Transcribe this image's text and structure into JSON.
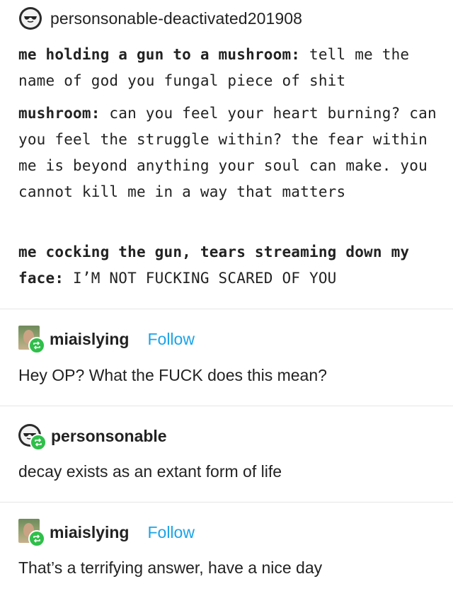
{
  "original_post": {
    "username": "personsonable-deactivated201908",
    "avatar_icon": "sunglasses-face-icon",
    "lines": [
      {
        "speaker": "me holding a gun to a mushroom:",
        "text": " tell me the name of god you fungal piece of shit"
      },
      {
        "speaker": "mushroom:",
        "text": " can you feel your heart burning? can you feel the struggle within? the fear within me is beyond anything your soul can make. you cannot kill me in a way that matters"
      },
      {
        "speaker": "me cocking the gun, tears streaming down my face:",
        "text": " I’M NOT FUCKING SCARED OF YOU"
      }
    ]
  },
  "reblogs": [
    {
      "username": "miaislying",
      "follow_label": "Follow",
      "text": "Hey OP? What the FUCK does this mean?",
      "avatar_icon": "meme-man-avatar-icon",
      "badge_icon": "reblog-icon"
    },
    {
      "username": "personsonable",
      "follow_label": "",
      "text": "decay exists as an extant form of life",
      "avatar_icon": "sunglasses-face-icon",
      "badge_icon": "reblog-icon"
    },
    {
      "username": "miaislying",
      "follow_label": "Follow",
      "text": "That’s a terrifying answer, have a nice day",
      "avatar_icon": "meme-man-avatar-icon",
      "badge_icon": "reblog-icon"
    }
  ],
  "colors": {
    "follow": "#1aa3e8",
    "reblog_badge": "#2fbf4a",
    "divider": "#e6e6e6"
  }
}
